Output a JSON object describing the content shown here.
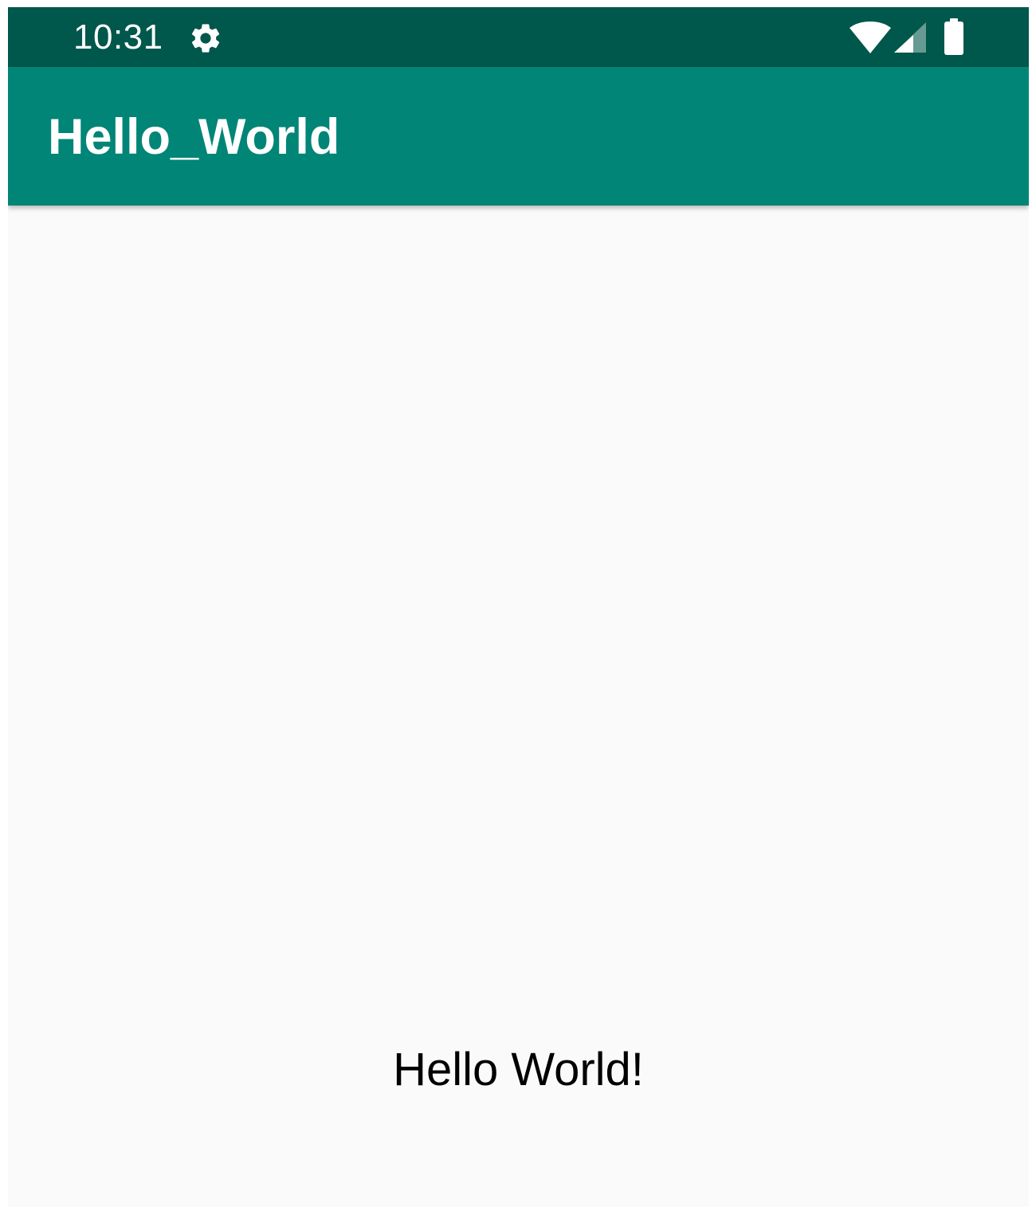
{
  "status_bar": {
    "time": "10:31",
    "icons": [
      "gear-icon",
      "wifi-icon",
      "cell-signal-icon",
      "battery-icon"
    ],
    "background_color": "#00574b"
  },
  "app_bar": {
    "title": "Hello_World",
    "background_color": "#008577"
  },
  "content": {
    "text": "Hello World!",
    "background_color": "#fafafa"
  }
}
